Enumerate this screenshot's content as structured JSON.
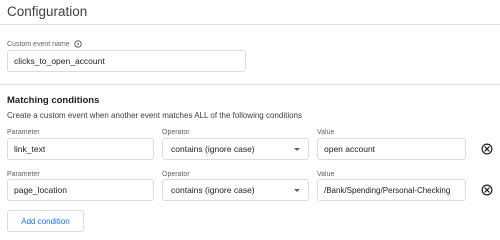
{
  "config": {
    "title": "Configuration",
    "custom_event_label": "Custom event name",
    "custom_event_value": "clicks_to_open_account"
  },
  "matching": {
    "title": "Matching conditions",
    "description": "Create a custom event when another event matches ALL of the following conditions",
    "param_label": "Parameter",
    "operator_label": "Operator",
    "value_label": "Value",
    "conditions": [
      {
        "parameter": "link_text",
        "operator": "contains (ignore case)",
        "value": "open account"
      },
      {
        "parameter": "page_location",
        "operator": "contains (ignore case)",
        "value": "/Bank/Spending/Personal-Checking"
      }
    ],
    "add_label": "Add condition"
  },
  "icons": {
    "help": "help-circle-icon",
    "dropdown": "caret-down-icon",
    "remove": "remove-circle-icon"
  },
  "colors": {
    "accent": "#1a73e8",
    "border": "#dadce0",
    "muted": "#5f6368"
  }
}
